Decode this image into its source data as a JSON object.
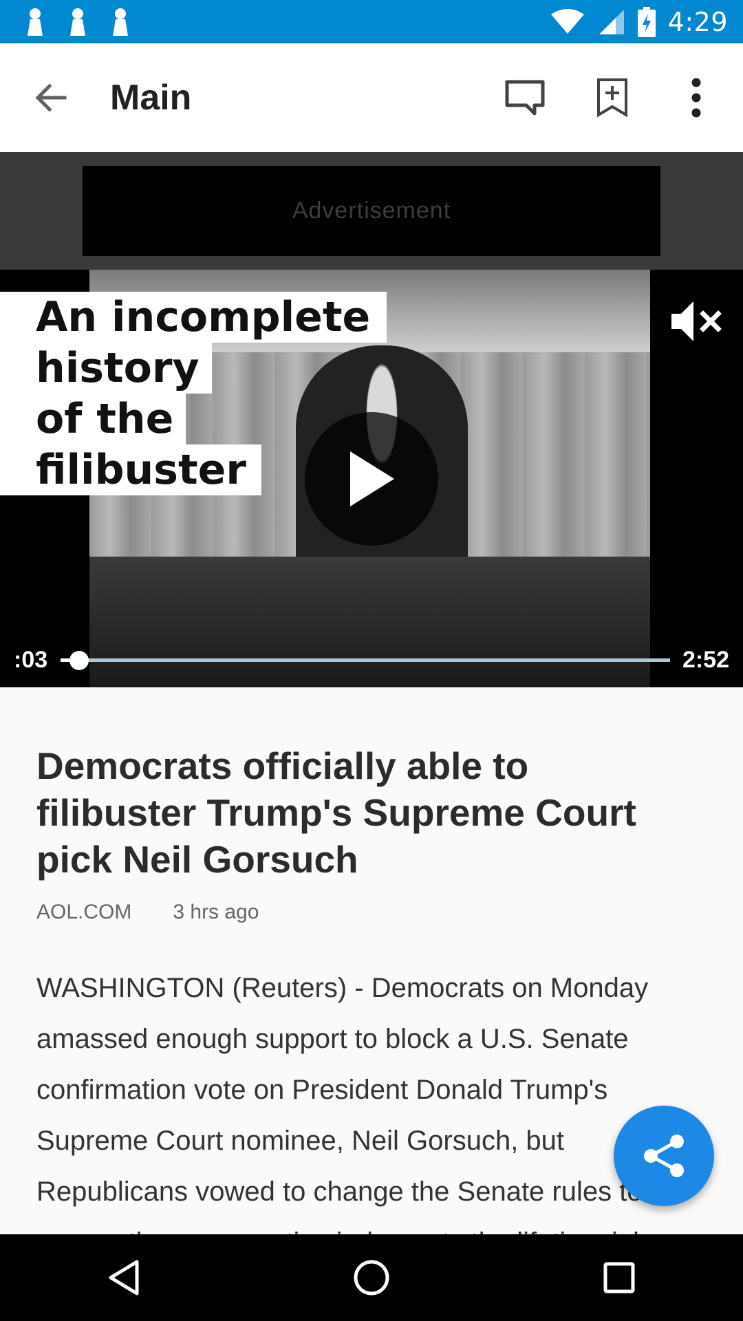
{
  "status_bar": {
    "time": "4:29",
    "left_icons": [
      "notification-icon",
      "notification-icon",
      "notification-icon"
    ],
    "right_icons": [
      "wifi-icon",
      "signal-icon",
      "battery-charging-icon"
    ]
  },
  "app_bar": {
    "title": "Main",
    "icons": [
      "back-arrow-icon",
      "comment-icon",
      "bookmark-add-icon",
      "more-vert-icon"
    ]
  },
  "ad": {
    "label": "Advertisement"
  },
  "video": {
    "caption_lines": [
      "An incomplete",
      "history",
      "of the",
      "filibuster"
    ],
    "current_time": ":03",
    "total_time": "2:52",
    "progress": 0.03,
    "muted": true
  },
  "article": {
    "headline": "Democrats officially able to filibuster Trump's Supreme Court pick Neil Gorsuch",
    "source": "AOL.COM",
    "time_ago": "3 hrs ago",
    "body": "WASHINGTON (Reuters) - Democrats on Monday amassed enough support to block a U.S. Senate confirmation vote on President Donald Trump's Supreme Court nominee, Neil Gorsuch, but Republicans vowed to change the Senate rules to ensure the conservative judge gets the lifetime job."
  },
  "colors": {
    "status_bar": "#0288d1",
    "fab": "#1e88e5",
    "headline": "#2b2b2b"
  }
}
